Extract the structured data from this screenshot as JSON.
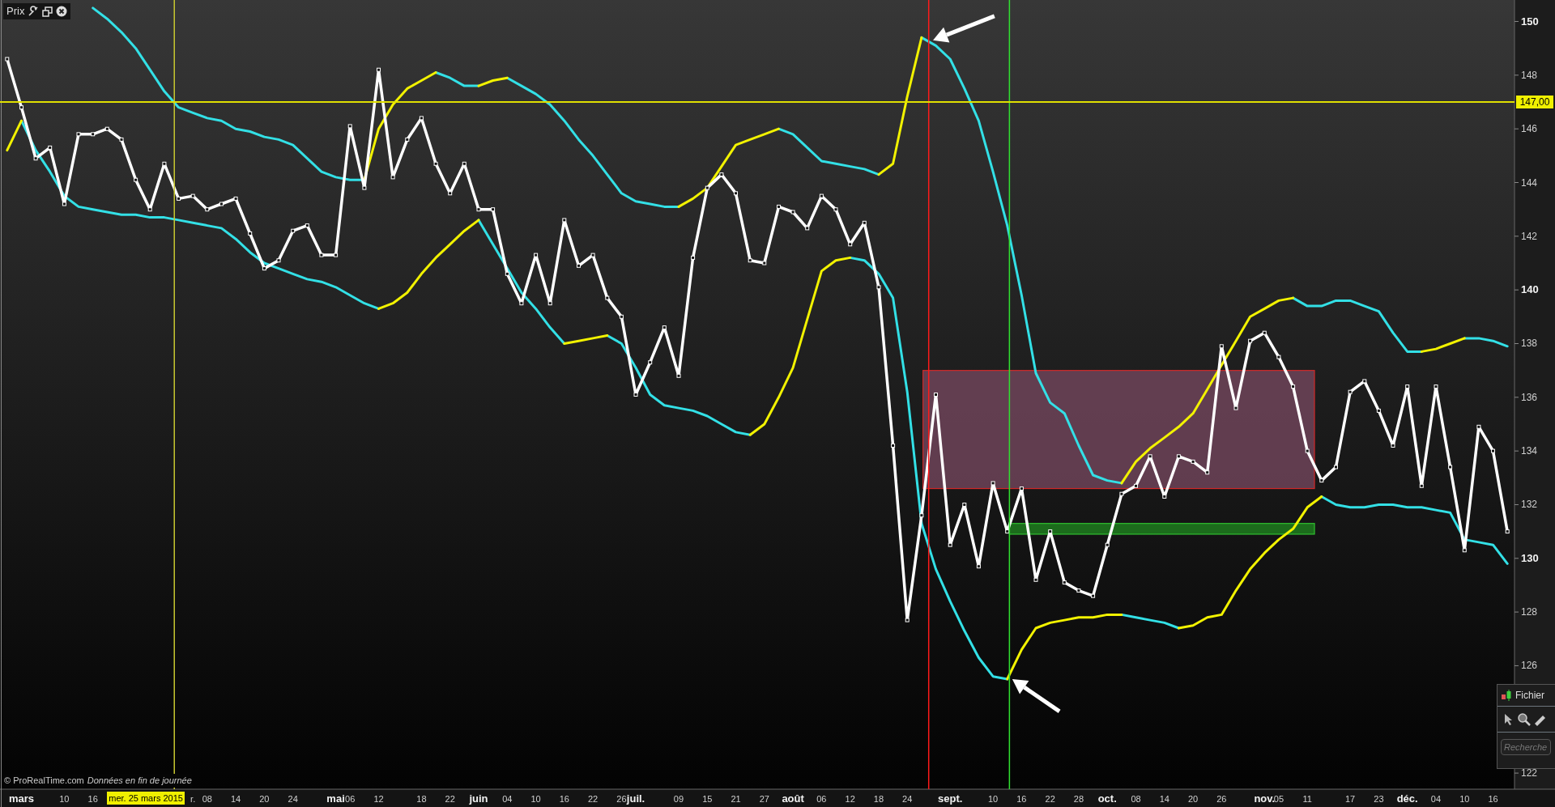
{
  "header": {
    "title": "Prix"
  },
  "chart": {
    "cursor_date": "mer. 25 mars 2015",
    "level_label": "147,00",
    "chart_data": {
      "type": "line",
      "ylim": [
        121.4,
        150.8
      ],
      "yticks": [
        122,
        126,
        128,
        130,
        132,
        134,
        136,
        138,
        140,
        142,
        144,
        146,
        148,
        150
      ],
      "categories": [
        null,
        "mars",
        null,
        null,
        "10",
        null,
        "16",
        null,
        null,
        null,
        null,
        null,
        null,
        "r.",
        "08",
        null,
        "14",
        null,
        "20",
        null,
        "24",
        null,
        null,
        "mai",
        "06",
        null,
        "12",
        null,
        null,
        "18",
        null,
        "22",
        null,
        "juin",
        null,
        "04",
        null,
        "10",
        null,
        "16",
        null,
        "22",
        null,
        "26",
        "juil.",
        null,
        null,
        "09",
        null,
        "15",
        null,
        "21",
        null,
        "27",
        null,
        "août",
        null,
        "06",
        null,
        "12",
        null,
        "18",
        null,
        "24",
        null,
        null,
        "sept.",
        null,
        null,
        "10",
        null,
        "16",
        null,
        "22",
        null,
        "28",
        null,
        "oct.",
        null,
        "08",
        null,
        "14",
        null,
        "20",
        null,
        "26",
        null,
        null,
        "nov.",
        "05",
        null,
        "11",
        null,
        null,
        "17",
        null,
        "23",
        null,
        "déc.",
        null,
        "04",
        null,
        "10",
        null,
        "16",
        null
      ],
      "series": [
        {
          "color": "#33e0e6",
          "values": [
            null,
            null,
            null,
            null,
            null,
            null,
            150.5,
            150.1,
            149.6,
            149.0,
            148.2,
            147.4,
            146.8,
            146.6,
            146.4,
            146.3,
            146.0,
            145.9,
            145.7,
            145.6,
            145.4,
            144.9,
            144.4,
            144.2,
            144.1,
            144.1,
            null,
            null,
            null,
            null,
            148.1,
            147.9,
            147.6,
            147.6,
            null,
            147.9,
            147.6,
            147.3,
            146.9,
            146.3,
            145.6,
            145.0,
            144.3,
            143.6,
            143.3,
            143.2,
            143.1,
            143.1,
            null,
            null,
            null,
            null,
            null,
            null,
            146.0,
            145.8,
            145.3,
            144.8,
            144.7,
            144.6,
            144.5,
            144.3,
            null,
            null,
            149.4,
            149.1,
            148.6,
            147.5,
            146.3,
            144.4,
            142.4,
            139.8,
            136.9,
            135.8,
            135.4,
            134.2,
            133.1,
            132.9,
            132.8,
            null,
            null,
            null,
            null,
            null,
            null,
            null,
            null,
            null,
            null,
            null,
            139.7,
            139.4,
            139.4,
            139.6,
            139.6,
            139.4,
            139.2,
            138.4,
            137.7,
            137.7,
            null,
            null,
            138.2,
            138.2,
            138.1,
            137.9
          ]
        },
        {
          "color": "#f2f200",
          "values": [
            null,
            null,
            null,
            null,
            null,
            null,
            null,
            null,
            null,
            null,
            null,
            null,
            null,
            null,
            null,
            null,
            null,
            null,
            null,
            null,
            null,
            null,
            null,
            null,
            null,
            144.1,
            146.0,
            146.9,
            147.5,
            147.8,
            148.1,
            null,
            null,
            147.6,
            147.8,
            147.9,
            null,
            null,
            null,
            null,
            null,
            null,
            null,
            null,
            null,
            null,
            null,
            143.1,
            143.4,
            143.8,
            144.6,
            145.4,
            145.6,
            145.8,
            146.0,
            null,
            null,
            null,
            null,
            null,
            null,
            144.3,
            144.7,
            147.2,
            149.4,
            null,
            null,
            null,
            null,
            null,
            null,
            null,
            null,
            null,
            null,
            null,
            null,
            null,
            132.8,
            133.6,
            134.1,
            134.5,
            134.9,
            135.4,
            136.3,
            137.2,
            138.1,
            139.0,
            139.3,
            139.6,
            139.7,
            null,
            null,
            null,
            null,
            null,
            null,
            null,
            null,
            137.7,
            137.8,
            138.0,
            138.2,
            null,
            null,
            null
          ]
        },
        {
          "color": "#33e0e6",
          "values": [
            null,
            146.3,
            145.2,
            144.4,
            143.5,
            143.1,
            143.0,
            142.9,
            142.8,
            142.8,
            142.7,
            142.7,
            142.6,
            142.5,
            142.4,
            142.3,
            141.9,
            141.4,
            141.0,
            140.8,
            140.6,
            140.4,
            140.3,
            140.1,
            139.8,
            139.5,
            139.3,
            null,
            null,
            null,
            null,
            null,
            null,
            142.6,
            141.7,
            140.8,
            139.9,
            139.3,
            138.6,
            138.0,
            null,
            null,
            138.3,
            138.0,
            137.1,
            136.1,
            135.7,
            135.6,
            135.5,
            135.3,
            135.0,
            134.7,
            134.6,
            null,
            null,
            null,
            null,
            null,
            null,
            141.2,
            141.1,
            140.6,
            139.7,
            136.2,
            131.3,
            129.6,
            128.4,
            127.3,
            126.3,
            125.6,
            125.5,
            null,
            null,
            null,
            null,
            null,
            null,
            null,
            127.9,
            127.8,
            127.7,
            127.6,
            127.4,
            null,
            null,
            null,
            null,
            null,
            null,
            null,
            null,
            null,
            132.3,
            132.0,
            131.9,
            131.9,
            132.0,
            132.0,
            131.9,
            131.9,
            131.8,
            131.7,
            130.7,
            130.6,
            130.5,
            129.8
          ]
        },
        {
          "color": "#f2f200",
          "values": [
            145.2,
            146.3,
            null,
            null,
            null,
            null,
            null,
            null,
            null,
            null,
            null,
            null,
            null,
            null,
            null,
            null,
            null,
            null,
            null,
            null,
            null,
            null,
            null,
            null,
            null,
            null,
            139.3,
            139.5,
            139.9,
            140.6,
            141.2,
            141.7,
            142.2,
            142.6,
            null,
            null,
            null,
            null,
            null,
            138.0,
            138.1,
            138.2,
            138.3,
            null,
            null,
            null,
            null,
            null,
            null,
            null,
            null,
            null,
            134.6,
            135.0,
            136.0,
            137.1,
            138.9,
            140.7,
            141.1,
            141.2,
            null,
            null,
            null,
            null,
            null,
            null,
            null,
            null,
            null,
            null,
            125.5,
            126.6,
            127.4,
            127.6,
            127.7,
            127.8,
            127.8,
            127.9,
            127.9,
            null,
            null,
            null,
            127.4,
            127.5,
            127.8,
            127.9,
            128.8,
            129.6,
            130.2,
            130.7,
            131.1,
            131.9,
            132.3,
            null,
            null,
            null,
            null,
            null,
            null,
            null,
            null,
            null,
            null,
            null,
            null,
            null
          ]
        },
        {
          "color": "#ffffff",
          "marker": "square",
          "values": [
            148.6,
            146.8,
            144.9,
            145.3,
            143.2,
            145.8,
            145.8,
            146.0,
            145.6,
            144.1,
            143.0,
            144.7,
            143.4,
            143.5,
            143.0,
            143.2,
            143.4,
            142.1,
            140.8,
            141.1,
            142.2,
            142.4,
            141.3,
            141.3,
            146.1,
            143.8,
            148.2,
            144.2,
            145.6,
            146.4,
            144.7,
            143.6,
            144.7,
            143.0,
            143.0,
            140.6,
            139.5,
            141.3,
            139.5,
            142.6,
            140.9,
            141.3,
            139.7,
            139.0,
            136.1,
            137.3,
            138.6,
            136.8,
            141.2,
            143.8,
            144.3,
            143.6,
            141.1,
            141.0,
            143.1,
            142.9,
            142.3,
            143.5,
            143.0,
            141.7,
            142.5,
            140.1,
            134.2,
            127.7,
            131.6,
            136.1,
            130.5,
            132.0,
            129.7,
            132.8,
            131.0,
            132.6,
            129.2,
            131.0,
            129.1,
            128.8,
            128.6,
            130.5,
            132.4,
            132.7,
            133.8,
            132.3,
            133.8,
            133.6,
            133.2,
            137.9,
            135.6,
            138.1,
            138.4,
            137.5,
            136.4,
            134.0,
            132.9,
            133.4,
            136.2,
            136.6,
            135.5,
            134.2,
            136.4,
            132.7,
            136.4,
            133.4,
            130.3,
            134.9,
            134.0,
            131.0
          ]
        }
      ]
    }
  },
  "footer": {
    "copyright": "© ProRealTime.com",
    "note": "Données en fin de journée"
  },
  "panel": {
    "menu": "Fichier",
    "search": {
      "placeholder": "Recherche"
    }
  }
}
